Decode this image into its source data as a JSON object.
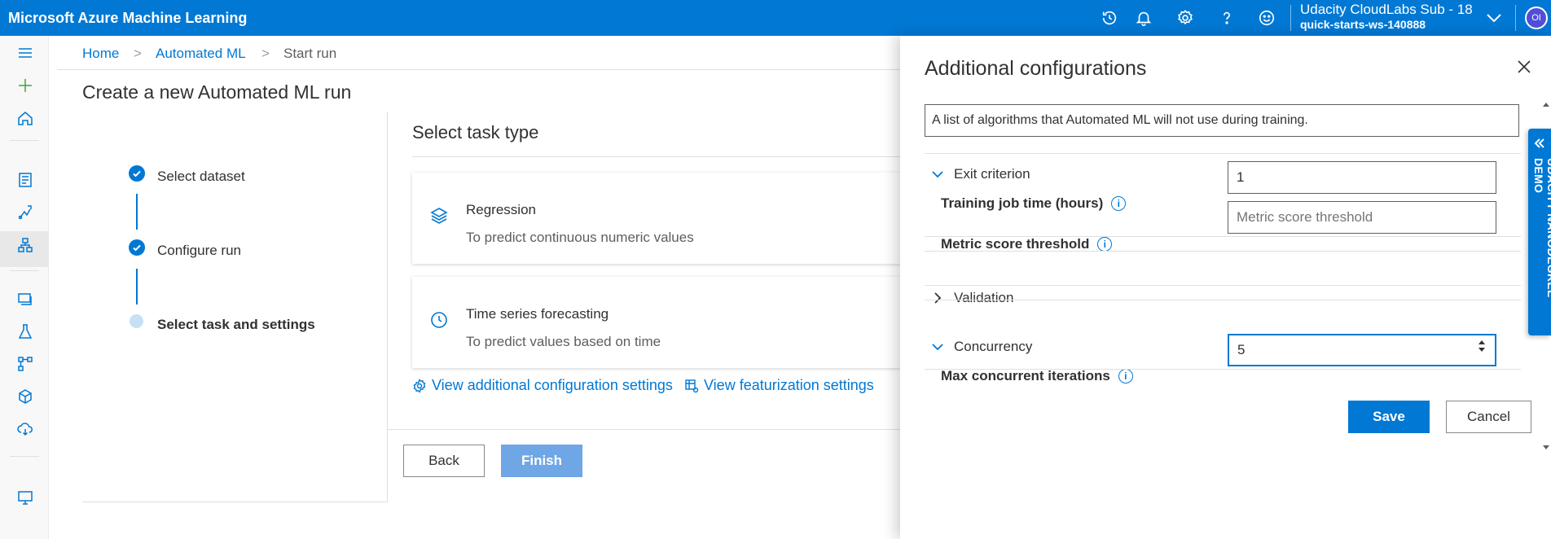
{
  "app": {
    "title": "Microsoft Azure Machine Learning"
  },
  "account": {
    "subscription": "Udacity CloudLabs Sub - 18",
    "workspace": "quick-starts-ws-140888",
    "initials": "OI"
  },
  "topbar_icons": [
    "history-icon",
    "bell-icon",
    "gear-icon",
    "help-icon",
    "smiley-icon"
  ],
  "breadcrumb": {
    "home": "Home",
    "automl": "Automated ML",
    "current": "Start run"
  },
  "page_title": "Create a new Automated ML run",
  "wizard": {
    "steps": [
      {
        "label": "Select dataset",
        "status": "complete"
      },
      {
        "label": "Configure run",
        "status": "complete"
      },
      {
        "label": "Select task and settings",
        "status": "current"
      }
    ]
  },
  "task": {
    "title": "Select task type",
    "cards": [
      {
        "title": "Regression",
        "desc": "To predict continuous numeric values",
        "icon": "layers-icon"
      },
      {
        "title": "Time series forecasting",
        "desc": "To predict values based on time",
        "icon": "clock-icon"
      }
    ],
    "links": {
      "additional": "View additional configuration settings",
      "featurization": "View featurization settings"
    },
    "back": "Back",
    "finish": "Finish"
  },
  "panel": {
    "title": "Additional configurations",
    "blocked_desc": "A list of algorithms that Automated ML will not use during training.",
    "exit": {
      "header": "Exit criterion",
      "training_label": "Training job time (hours)",
      "training_value": "1",
      "metric_label": "Metric score threshold",
      "metric_placeholder": "Metric score threshold"
    },
    "validation": {
      "header": "Validation"
    },
    "concurrency": {
      "header": "Concurrency",
      "max_label": "Max concurrent iterations",
      "max_value": "5"
    },
    "save": "Save",
    "cancel": "Cancel"
  },
  "side_tab": {
    "label": "UDACITY NANODEGREE DEMO"
  },
  "colors": {
    "brand": "#0078d4",
    "finish_disabled": "#6fa6e6"
  }
}
